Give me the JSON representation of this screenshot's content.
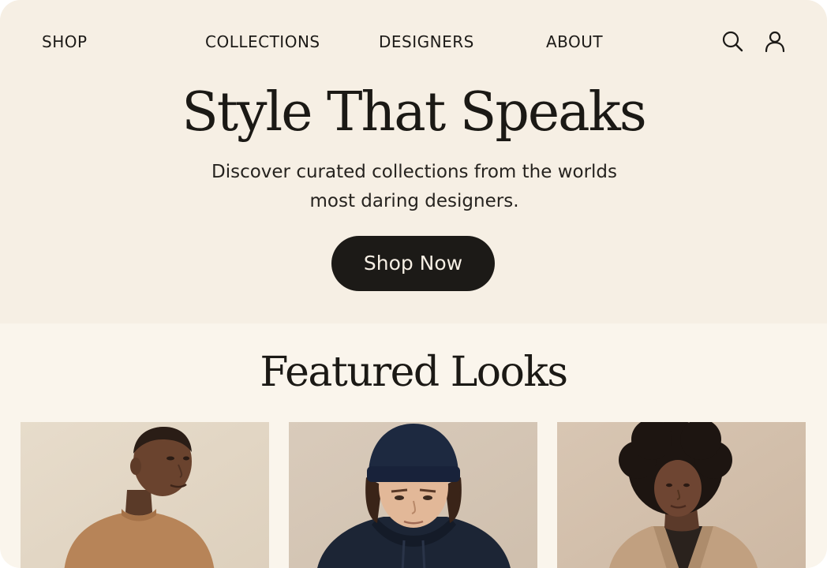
{
  "nav": {
    "links": [
      {
        "label": "SHOP"
      },
      {
        "label": "COLLECTIONS"
      },
      {
        "label": "DESIGNERS"
      },
      {
        "label": "ABOUT"
      }
    ],
    "icons": [
      "search-icon",
      "user-icon"
    ]
  },
  "hero": {
    "title": "Style That Speaks",
    "subtitle": "Discover curated collections from the worlds most daring designers.",
    "cta_label": "Shop Now"
  },
  "featured": {
    "title": "Featured Looks",
    "looks": [
      {
        "image": "man-in-tan-sweater-photo"
      },
      {
        "image": "man-in-navy-beanie-photo"
      },
      {
        "image": "woman-in-beige-blazer-photo"
      }
    ]
  },
  "colors": {
    "hero_background": "#f6efe4",
    "page_background": "#faf5ec",
    "text": "#1c1a17",
    "button_background": "#1c1a17",
    "button_text": "#f6efe4"
  }
}
